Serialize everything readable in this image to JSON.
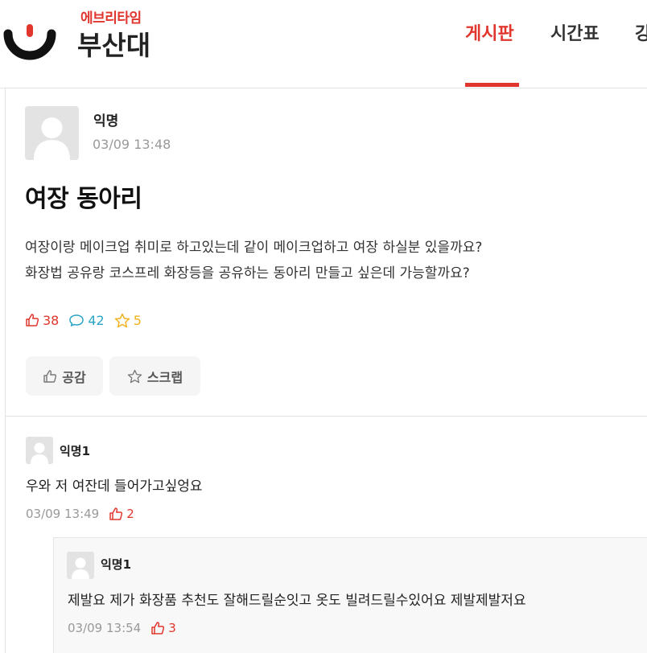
{
  "brand": {
    "subtitle": "에브리타임",
    "school": "부산대",
    "accent_color": "#e0362e",
    "logo_icon": "everytime-smile-logo"
  },
  "nav": {
    "items": [
      {
        "label": "게시판",
        "active": true
      },
      {
        "label": "시간표",
        "active": false
      },
      {
        "label": "강",
        "active": false
      }
    ]
  },
  "post": {
    "author": "익명",
    "date": "03/09 13:48",
    "title": "여장 동아리",
    "body": [
      "여장이랑 메이크업 취미로 하고있는데 같이 메이크업하고 여장 하실분 있을까요?",
      "화장법 공유랑 코스프레 화장등을 공유하는 동아리 만들고 싶은데 가능할까요?"
    ],
    "stats": {
      "likes": "38",
      "comments": "42",
      "scraps": "5"
    },
    "buttons": {
      "like": "공감",
      "scrap": "스크랩"
    }
  },
  "comments": [
    {
      "author": "익명1",
      "text": "우와 저 여잔데 들어가고싶엉요",
      "date": "03/09 13:49",
      "likes": "2"
    },
    {
      "author": "익명1",
      "text": "제발요 제가 화장품 추천도 잘해드릴순잇고 옷도 빌려드릴수있어요 제발제발저요",
      "date": "03/09 13:54",
      "likes": "3",
      "is_reply": true
    }
  ]
}
